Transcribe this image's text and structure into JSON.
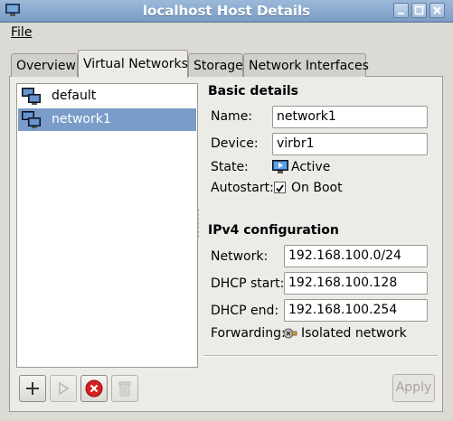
{
  "window": {
    "title": "localhost Host Details"
  },
  "menu": {
    "file": "File"
  },
  "tabs": [
    {
      "label": "Overview"
    },
    {
      "label": "Virtual Networks"
    },
    {
      "label": "Storage"
    },
    {
      "label": "Network Interfaces"
    }
  ],
  "networks": [
    {
      "name": "default"
    },
    {
      "name": "network1"
    }
  ],
  "basic": {
    "heading": "Basic details",
    "name_label": "Name:",
    "name_value": "network1",
    "device_label": "Device:",
    "device_value": "virbr1",
    "state_label": "State:",
    "state_value": "Active",
    "autostart_label": "Autostart:",
    "autostart_value": "On Boot"
  },
  "ipv4": {
    "heading": "IPv4 configuration",
    "network_label": "Network:",
    "network_value": "192.168.100.0/24",
    "dhcp_start_label": "DHCP start:",
    "dhcp_start_value": "192.168.100.128",
    "dhcp_end_label": "DHCP end:",
    "dhcp_end_value": "192.168.100.254",
    "forwarding_label": "Forwarding:",
    "forwarding_value": "Isolated network"
  },
  "actions": {
    "apply": "Apply"
  }
}
